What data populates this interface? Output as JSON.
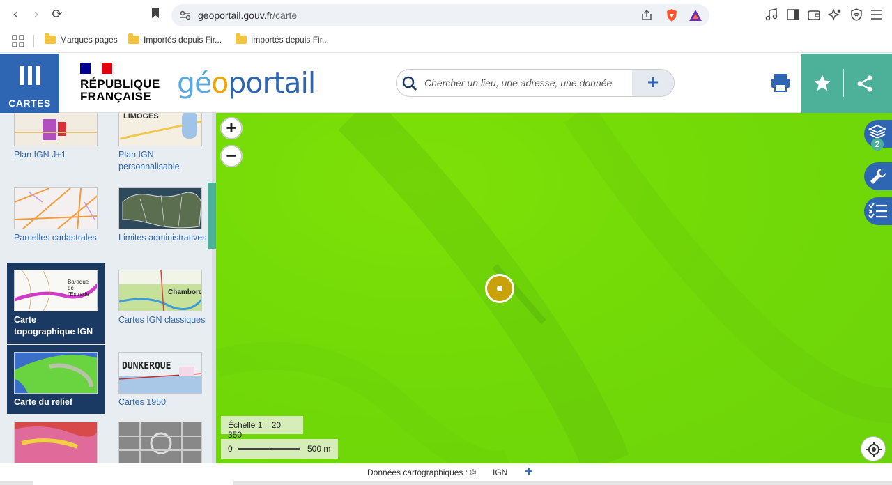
{
  "browser": {
    "url_host": "geoportail.gouv.fr",
    "url_path": "/carte",
    "bookmarks": [
      "Marques pages",
      "Importés depuis Fir...",
      "Importés depuis Fir..."
    ]
  },
  "header": {
    "cartes_label": "CARTES",
    "rf_line1": "RÉPUBLIQUE",
    "rf_line2": "FRANÇAISE",
    "logo_geo": "géo",
    "logo_portail": "portail",
    "search_placeholder": "Chercher un lieu, une adresse, une donnée",
    "search_add": "+"
  },
  "sidebar": {
    "tiles": [
      {
        "label": "Plan IGN J+1",
        "thumb_text": ""
      },
      {
        "label": "Plan IGN personnalisable",
        "thumb_text": "LIMOGES"
      },
      {
        "label": "Parcelles cadastrales",
        "thumb_text": ""
      },
      {
        "label": "Limites administratives",
        "thumb_text": ""
      },
      {
        "label": "Carte topographique IGN",
        "thumb_text": "Baraque de l'Estrade"
      },
      {
        "label": "Cartes IGN classiques",
        "thumb_text": "Chambord"
      },
      {
        "label": "Carte du relief",
        "thumb_text": ""
      },
      {
        "label": "Cartes 1950",
        "thumb_text": "DUNKERQUE"
      }
    ]
  },
  "map": {
    "zoom_in": "+",
    "zoom_out": "−",
    "layers_count": "2",
    "scale_label": "Échelle 1 :",
    "scale_value": "20 350",
    "scale_zero": "0",
    "scale_distance": "500 m"
  },
  "footer": {
    "credits_label": "Données cartographiques : ©",
    "credits_provider": "IGN",
    "expand": "+"
  },
  "colors": {
    "brand_blue": "#2f66b3",
    "brand_green": "#4db19a",
    "map_green": "#74db07",
    "marker": "#c9a20a"
  }
}
